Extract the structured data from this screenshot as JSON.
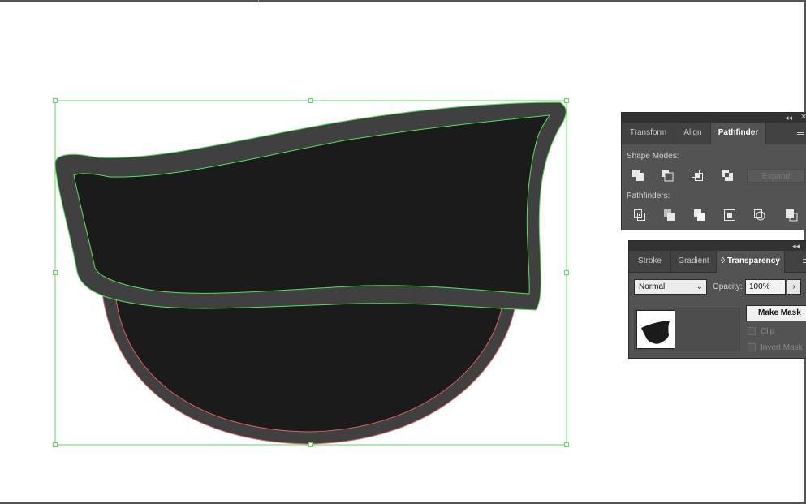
{
  "pathfinder_panel": {
    "tabs": [
      {
        "label": "Transform",
        "active": false
      },
      {
        "label": "Align",
        "active": false
      },
      {
        "label": "Pathfinder",
        "active": true
      }
    ],
    "shape_modes_label": "Shape Modes:",
    "pathfinders_label": "Pathfinders:",
    "expand_label": "Expand",
    "shape_mode_icons": [
      "unite-icon",
      "minus-front-icon",
      "intersect-icon",
      "exclude-icon"
    ],
    "pathfinder_icons": [
      "divide-icon",
      "trim-icon",
      "merge-icon",
      "crop-icon",
      "outline-icon",
      "minus-back-icon"
    ]
  },
  "transparency_panel": {
    "tabs": [
      {
        "label": "Stroke",
        "active": false
      },
      {
        "label": "Gradient",
        "active": false
      },
      {
        "label": "Transparency",
        "active": true
      }
    ],
    "blend_mode": "Normal",
    "opacity_label": "Opacity:",
    "opacity_value": "100%",
    "make_mask_label": "Make Mask",
    "clip_label": "Clip",
    "invert_mask_label": "Invert Mask"
  },
  "colors": {
    "selection_green": "#55e055",
    "selection_red": "#e06060",
    "shape_fill": "#1b1b1b",
    "shape_stroke": "#404040",
    "panel_bg": "#535353",
    "tab_bg": "#424242"
  }
}
